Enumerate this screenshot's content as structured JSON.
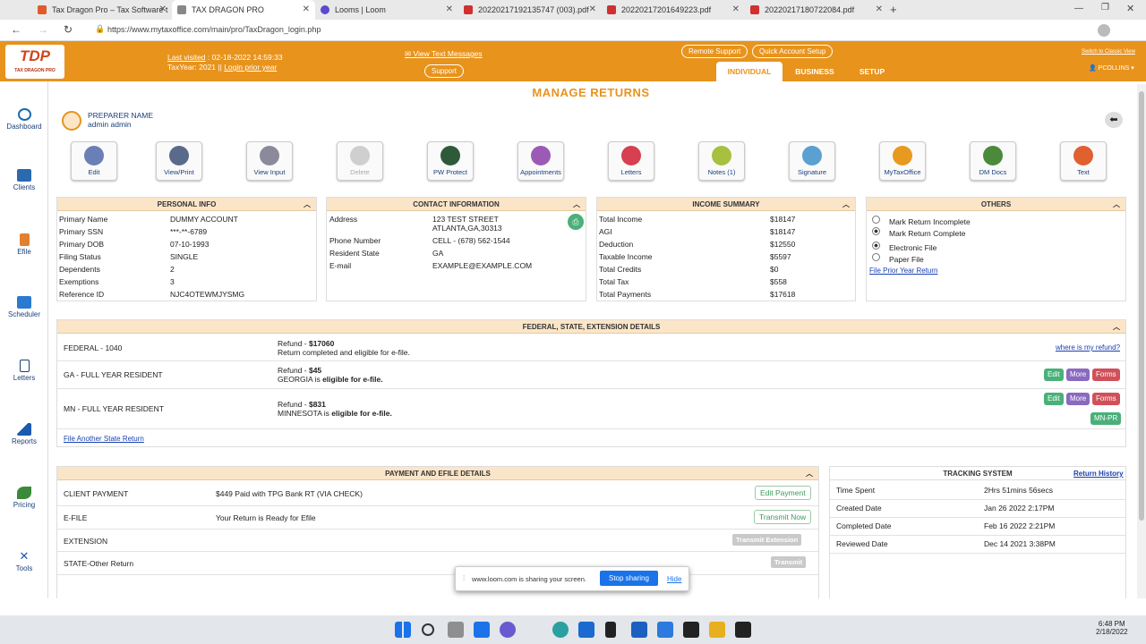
{
  "browser": {
    "tabs": [
      {
        "label": "Tax Dragon Pro – Tax Software t"
      },
      {
        "label": "TAX DRAGON PRO"
      },
      {
        "label": "Looms | Loom"
      },
      {
        "label": "20220217192135747 (003).pdf"
      },
      {
        "label": "20220217201649223.pdf"
      },
      {
        "label": "20220217180722084.pdf"
      }
    ],
    "url": "https://www.mytaxoffice.com/main/pro/TaxDragon_login.php"
  },
  "header": {
    "logo": "TDP",
    "logo_sub": "TAX DRAGON PRO",
    "last_visited_label": "Last visited",
    "last_visited_value": ": 02-18-2022 14:59:33",
    "taxyear": "TaxYear:  2021  ||",
    "login_prior": "Login prior year",
    "view_text": "✉ View Text Messages",
    "support": "Support",
    "remote": "Remote Support",
    "quick": "Quick Account Setup",
    "classic": "Switch to Classic View",
    "tabs": [
      "INDIVIDUAL",
      "BUSINESS",
      "SETUP"
    ],
    "user": "PCOLLINS ▾"
  },
  "nav": [
    {
      "label": "Dashboard"
    },
    {
      "label": "Clients"
    },
    {
      "label": "Efile"
    },
    {
      "label": "Scheduler"
    },
    {
      "label": "Letters"
    },
    {
      "label": "Reports"
    },
    {
      "label": "Pricing"
    },
    {
      "label": "Tools"
    }
  ],
  "title": "MANAGE RETURNS",
  "preparer": {
    "label": "PREPARER NAME",
    "name": "admin admin"
  },
  "toolbar": [
    {
      "label": "Edit",
      "color": "#6a7fb5"
    },
    {
      "label": "View/Print",
      "color": "#5a6a8a"
    },
    {
      "label": "View Input",
      "color": "#8a8a9a"
    },
    {
      "label": "Delete",
      "color": "#cfcfcf"
    },
    {
      "label": "PW Protect",
      "color": "#2e5a3a"
    },
    {
      "label": "Appointments",
      "color": "#9a5ab5"
    },
    {
      "label": "Letters",
      "color": "#d64050"
    },
    {
      "label": "Notes (1)",
      "color": "#a8c040"
    },
    {
      "label": "Signature",
      "color": "#5aa0d0"
    },
    {
      "label": "MyTaxOffice",
      "color": "#e89a20"
    },
    {
      "label": "DM Docs",
      "color": "#4a8a3a"
    },
    {
      "label": "Text",
      "color": "#e06030"
    }
  ],
  "personal": {
    "title": "PERSONAL INFO",
    "rows": [
      [
        "Primary Name",
        "DUMMY ACCOUNT"
      ],
      [
        "Primary SSN",
        "***-**-6789"
      ],
      [
        "Primary DOB",
        "07-10-1993"
      ],
      [
        "Filing Status",
        "SINGLE"
      ],
      [
        "Dependents",
        "2"
      ],
      [
        "Exemptions",
        "3"
      ],
      [
        "Reference ID",
        "NJC4OTEWMJYSMG"
      ]
    ]
  },
  "contact": {
    "title": "CONTACT INFORMATION",
    "address_label": "Address",
    "address1": "123 TEST STREET",
    "address2": "ATLANTA,GA,30313",
    "phone_label": "Phone Number",
    "phone": "CELL - (678) 562-1544",
    "state_label": "Resident State",
    "state": "GA",
    "email_label": "E-mail",
    "email": "EXAMPLE@EXAMPLE.COM"
  },
  "income": {
    "title": "INCOME SUMMARY",
    "rows": [
      [
        "Total Income",
        "$18147"
      ],
      [
        "AGI",
        "$18147"
      ],
      [
        "Deduction",
        "$12550"
      ],
      [
        "Taxable Income",
        "$5597"
      ],
      [
        "Total Credits",
        "$0"
      ],
      [
        "Total Tax",
        "$558"
      ],
      [
        "Total Payments",
        "$17618"
      ]
    ]
  },
  "others": {
    "title": "OTHERS",
    "opt1": "Mark Return Incomplete",
    "opt2": "Mark Return Complete",
    "opt3": "Electronic File",
    "opt4": "Paper File",
    "link": "File Prior Year Return"
  },
  "federal": {
    "title": "FEDERAL, STATE, EXTENSION DETAILS",
    "rows": [
      {
        "name": "FEDERAL - 1040",
        "refund_label": "Refund - ",
        "amount": "$17060",
        "line2a": "Return completed and eligible for e-file.",
        "line2b": ""
      },
      {
        "name": "GA - FULL YEAR RESIDENT",
        "refund_label": "Refund - ",
        "amount": "$45",
        "line2a": "GEORGIA is ",
        "line2b": "eligible for e-file."
      },
      {
        "name": "MN - FULL YEAR RESIDENT",
        "refund_label": "Refund - ",
        "amount": "$831",
        "line2a": "MINNESOTA is ",
        "line2b": "eligible for e-file."
      }
    ],
    "where": "where is my refund?",
    "edit": "Edit",
    "more": "More",
    "forms": "Forms",
    "mnpr": "MN-PR",
    "another": "File Another State Return"
  },
  "payment": {
    "title": "PAYMENT AND EFILE DETAILS",
    "rows": [
      {
        "label": "CLIENT PAYMENT",
        "value": "$449 Paid with TPG Bank RT (VIA CHECK)",
        "btn": "Edit Payment"
      },
      {
        "label": "E-FILE",
        "value": "Your Return is Ready for Efile",
        "btn": "Transmit Now"
      },
      {
        "label": "EXTENSION",
        "value": "",
        "btn": "Transmit Extension"
      },
      {
        "label": "STATE-Other Return",
        "value": "",
        "btn": "Transmit"
      }
    ]
  },
  "tracking": {
    "title": "TRACKING SYSTEM",
    "history": "Return History",
    "rows": [
      [
        "Time Spent",
        "2Hrs 51mins 56secs"
      ],
      [
        "Created Date",
        "Jan 26 2022 2:17PM"
      ],
      [
        "Completed Date",
        "Feb 16 2022 2:21PM"
      ],
      [
        "Reviewed Date",
        "Dec 14 2021 3:38PM"
      ]
    ]
  },
  "loom": {
    "text": "www.loom.com is sharing your screen.",
    "stop": "Stop sharing",
    "hide": "Hide"
  },
  "taskbar": {
    "time": "6:48 PM",
    "date": "2/18/2022"
  }
}
